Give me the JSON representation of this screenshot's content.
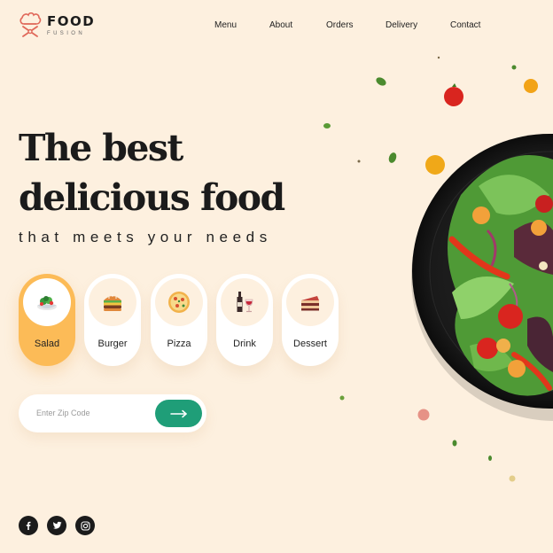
{
  "brand": {
    "name": "FOOD",
    "subtitle": "FUSION"
  },
  "nav": [
    {
      "label": "Menu"
    },
    {
      "label": "About"
    },
    {
      "label": "Orders"
    },
    {
      "label": "Delivery"
    },
    {
      "label": "Contact"
    }
  ],
  "hero": {
    "headline_line1": "The best",
    "headline_line2": "delicious food",
    "tagline": "that meets your needs"
  },
  "categories": [
    {
      "label": "Salad",
      "icon": "salad-icon",
      "active": true
    },
    {
      "label": "Burger",
      "icon": "burger-icon",
      "active": false
    },
    {
      "label": "Pizza",
      "icon": "pizza-icon",
      "active": false
    },
    {
      "label": "Drink",
      "icon": "drink-icon",
      "active": false
    },
    {
      "label": "Dessert",
      "icon": "dessert-icon",
      "active": false
    }
  ],
  "zip": {
    "placeholder": "Enter Zip Code",
    "submit_icon": "arrow-right-icon"
  },
  "social": [
    {
      "icon": "facebook-icon"
    },
    {
      "icon": "twitter-icon"
    },
    {
      "icon": "instagram-icon"
    }
  ],
  "colors": {
    "background": "#fdf0df",
    "accent": "#fcbb57",
    "button": "#1f9e78",
    "brand": "#e0685a",
    "text": "#1b1b1b"
  }
}
